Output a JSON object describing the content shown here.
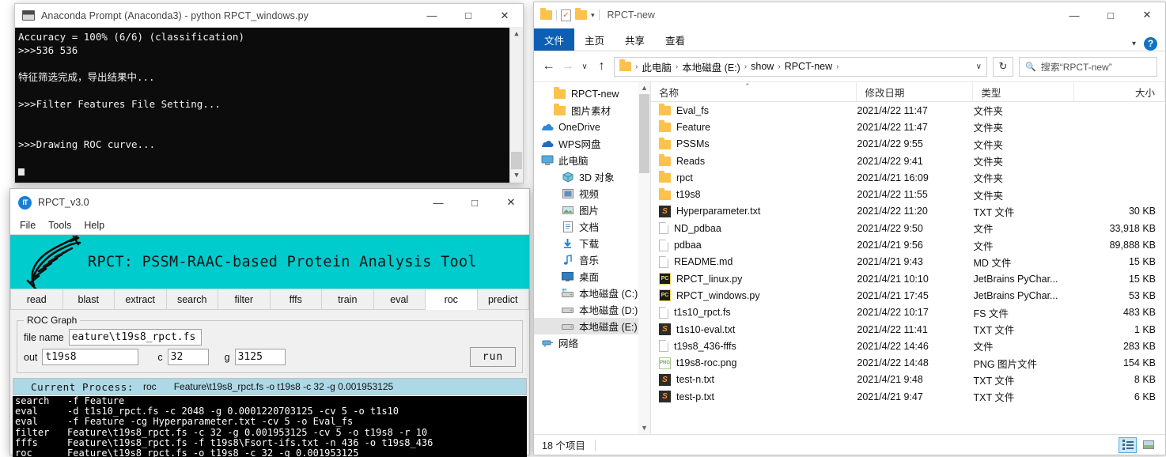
{
  "anaconda": {
    "title": "Anaconda Prompt (Anaconda3) - python  RPCT_windows.py",
    "icon": "console-icon",
    "minimize": "—",
    "maximize": "□",
    "close": "✕",
    "lines": [
      "Accuracy = 100% (6/6) (classification)",
      ">>>536 536",
      "",
      "特征筛选完成，导出结果中...",
      "",
      ">>>Filter Features File Setting...",
      "",
      "",
      ">>>Drawing ROC curve..."
    ]
  },
  "rpct": {
    "title": "RPCT_v3.0",
    "icon_text": "Ⓜ",
    "minimize": "—",
    "maximize": "□",
    "close": "✕",
    "menus": [
      "File",
      "Tools",
      "Help"
    ],
    "banner_title": "RPCT: PSSM-RAAC-based Protein Analysis Tool",
    "banner_color": "#00ccce",
    "tabs": [
      {
        "label": "read",
        "active": false
      },
      {
        "label": "blast",
        "active": false
      },
      {
        "label": "extract",
        "active": false
      },
      {
        "label": "search",
        "active": false
      },
      {
        "label": "filter",
        "active": false
      },
      {
        "label": "fffs",
        "active": false
      },
      {
        "label": "train",
        "active": false
      },
      {
        "label": "eval",
        "active": false
      },
      {
        "label": "roc",
        "active": true
      },
      {
        "label": "predict",
        "active": false
      }
    ],
    "form": {
      "group_label": "ROC Graph",
      "filename_label": "file name",
      "filename_value": "eature\\t19s8_rpct.fs",
      "out_label": "out",
      "out_value": "t19s8",
      "c_label": "c",
      "c_value": "32",
      "g_label": "g",
      "g_value": "3125",
      "run_label": "run"
    },
    "status": {
      "label": "Current Process:",
      "process": "roc",
      "command": "Feature\\t19s8_rpct.fs -o t19s8 -c 32 -g 0.001953125",
      "bg": "#add8e6"
    },
    "log": [
      {
        "cmd": "search",
        "args": "-f Feature"
      },
      {
        "cmd": "eval",
        "args": "-d t1s10_rpct.fs -c 2048 -g 0.0001220703125 -cv 5 -o t1s10"
      },
      {
        "cmd": "eval",
        "args": "-f Feature -cg Hyperparameter.txt -cv 5 -o Eval_fs"
      },
      {
        "cmd": "filter",
        "args": "Feature\\t19s8_rpct.fs -c 32 -g 0.001953125 -cv 5 -o t19s8 -r 10"
      },
      {
        "cmd": "fffs",
        "args": "Feature\\t19s8_rpct.fs -f t19s8\\Fsort-ifs.txt -n 436 -o t19s8_436"
      },
      {
        "cmd": "roc",
        "args": "Feature\\t19s8_rpct.fs -o t19s8 -c 32 -g 0.001953125"
      }
    ]
  },
  "explorer": {
    "title": "RPCT-new",
    "minimize": "—",
    "maximize": "□",
    "close": "✕",
    "ribbon_tabs": [
      {
        "label": "文件",
        "active": true
      },
      {
        "label": "主页",
        "active": false
      },
      {
        "label": "共享",
        "active": false
      },
      {
        "label": "查看",
        "active": false
      }
    ],
    "help_label": "?",
    "address": {
      "back": "←",
      "forward": "→",
      "recent": "∨",
      "up": "↑",
      "crumbs": [
        "此电脑",
        "本地磁盘 (E:)",
        "show",
        "RPCT-new"
      ],
      "dropdown": "∨",
      "refresh": "↻"
    },
    "search": {
      "icon": "search-icon",
      "placeholder": "搜索“RPCT-new”"
    },
    "sidebar": [
      {
        "label": "RPCT-new",
        "icon": "folder",
        "indent": 1,
        "selected": false
      },
      {
        "label": "图片素材",
        "icon": "folder",
        "indent": 1,
        "selected": false
      },
      {
        "label": "OneDrive",
        "icon": "cloud",
        "indent": 0,
        "selected": false
      },
      {
        "label": "WPS网盘",
        "icon": "cloud2",
        "indent": 0,
        "selected": false
      },
      {
        "label": "此电脑",
        "icon": "pc",
        "indent": 0,
        "selected": false
      },
      {
        "label": "3D 对象",
        "icon": "cube",
        "indent": 1,
        "selected": false
      },
      {
        "label": "视频",
        "icon": "video",
        "indent": 1,
        "selected": false
      },
      {
        "label": "图片",
        "icon": "picture",
        "indent": 1,
        "selected": false
      },
      {
        "label": "文档",
        "icon": "document",
        "indent": 1,
        "selected": false
      },
      {
        "label": "下载",
        "icon": "download",
        "indent": 1,
        "selected": false
      },
      {
        "label": "音乐",
        "icon": "music",
        "indent": 1,
        "selected": false
      },
      {
        "label": "桌面",
        "icon": "desktop",
        "indent": 1,
        "selected": false
      },
      {
        "label": "本地磁盘 (C:)",
        "icon": "disk-system",
        "indent": 1,
        "selected": false
      },
      {
        "label": "本地磁盘 (D:)",
        "icon": "disk",
        "indent": 1,
        "selected": false
      },
      {
        "label": "本地磁盘 (E:)",
        "icon": "disk",
        "indent": 1,
        "selected": true
      },
      {
        "label": "网络",
        "icon": "network",
        "indent": 0,
        "selected": false
      }
    ],
    "columns": [
      "名称",
      "修改日期",
      "类型",
      "大小"
    ],
    "sort_indicator": "⌃",
    "files": [
      {
        "name": "Eval_fs",
        "date": "2021/4/22 11:47",
        "type": "文件夹",
        "size": "",
        "icon": "folder"
      },
      {
        "name": "Feature",
        "date": "2021/4/22 11:47",
        "type": "文件夹",
        "size": "",
        "icon": "folder"
      },
      {
        "name": "PSSMs",
        "date": "2021/4/22 9:55",
        "type": "文件夹",
        "size": "",
        "icon": "folder"
      },
      {
        "name": "Reads",
        "date": "2021/4/22 9:41",
        "type": "文件夹",
        "size": "",
        "icon": "folder"
      },
      {
        "name": "rpct",
        "date": "2021/4/21 16:09",
        "type": "文件夹",
        "size": "",
        "icon": "folder"
      },
      {
        "name": "t19s8",
        "date": "2021/4/22 11:55",
        "type": "文件夹",
        "size": "",
        "icon": "folder"
      },
      {
        "name": "Hyperparameter.txt",
        "date": "2021/4/22 11:20",
        "type": "TXT 文件",
        "size": "30 KB",
        "icon": "sublime"
      },
      {
        "name": "ND_pdbaa",
        "date": "2021/4/22 9:50",
        "type": "文件",
        "size": "33,918 KB",
        "icon": "doc"
      },
      {
        "name": "pdbaa",
        "date": "2021/4/21 9:56",
        "type": "文件",
        "size": "89,888 KB",
        "icon": "doc"
      },
      {
        "name": "README.md",
        "date": "2021/4/21 9:43",
        "type": "MD 文件",
        "size": "15 KB",
        "icon": "doc"
      },
      {
        "name": "RPCT_linux.py",
        "date": "2021/4/21 10:10",
        "type": "JetBrains PyChar...",
        "size": "15 KB",
        "icon": "pycharm"
      },
      {
        "name": "RPCT_windows.py",
        "date": "2021/4/21 17:45",
        "type": "JetBrains PyChar...",
        "size": "53 KB",
        "icon": "pycharm"
      },
      {
        "name": "t1s10_rpct.fs",
        "date": "2021/4/22 10:17",
        "type": "FS 文件",
        "size": "483 KB",
        "icon": "doc"
      },
      {
        "name": "t1s10-eval.txt",
        "date": "2021/4/22 11:41",
        "type": "TXT 文件",
        "size": "1 KB",
        "icon": "sublime"
      },
      {
        "name": "t19s8_436-fffs",
        "date": "2021/4/22 14:46",
        "type": "文件",
        "size": "283 KB",
        "icon": "doc"
      },
      {
        "name": "t19s8-roc.png",
        "date": "2021/4/22 14:48",
        "type": "PNG 图片文件",
        "size": "154 KB",
        "icon": "png"
      },
      {
        "name": "test-n.txt",
        "date": "2021/4/21 9:48",
        "type": "TXT 文件",
        "size": "8 KB",
        "icon": "sublime"
      },
      {
        "name": "test-p.txt",
        "date": "2021/4/21 9:47",
        "type": "TXT 文件",
        "size": "6 KB",
        "icon": "sublime"
      }
    ],
    "status": {
      "count": "18 个项目",
      "view_details": "details-view",
      "view_thumbnails": "thumbnail-view"
    }
  }
}
